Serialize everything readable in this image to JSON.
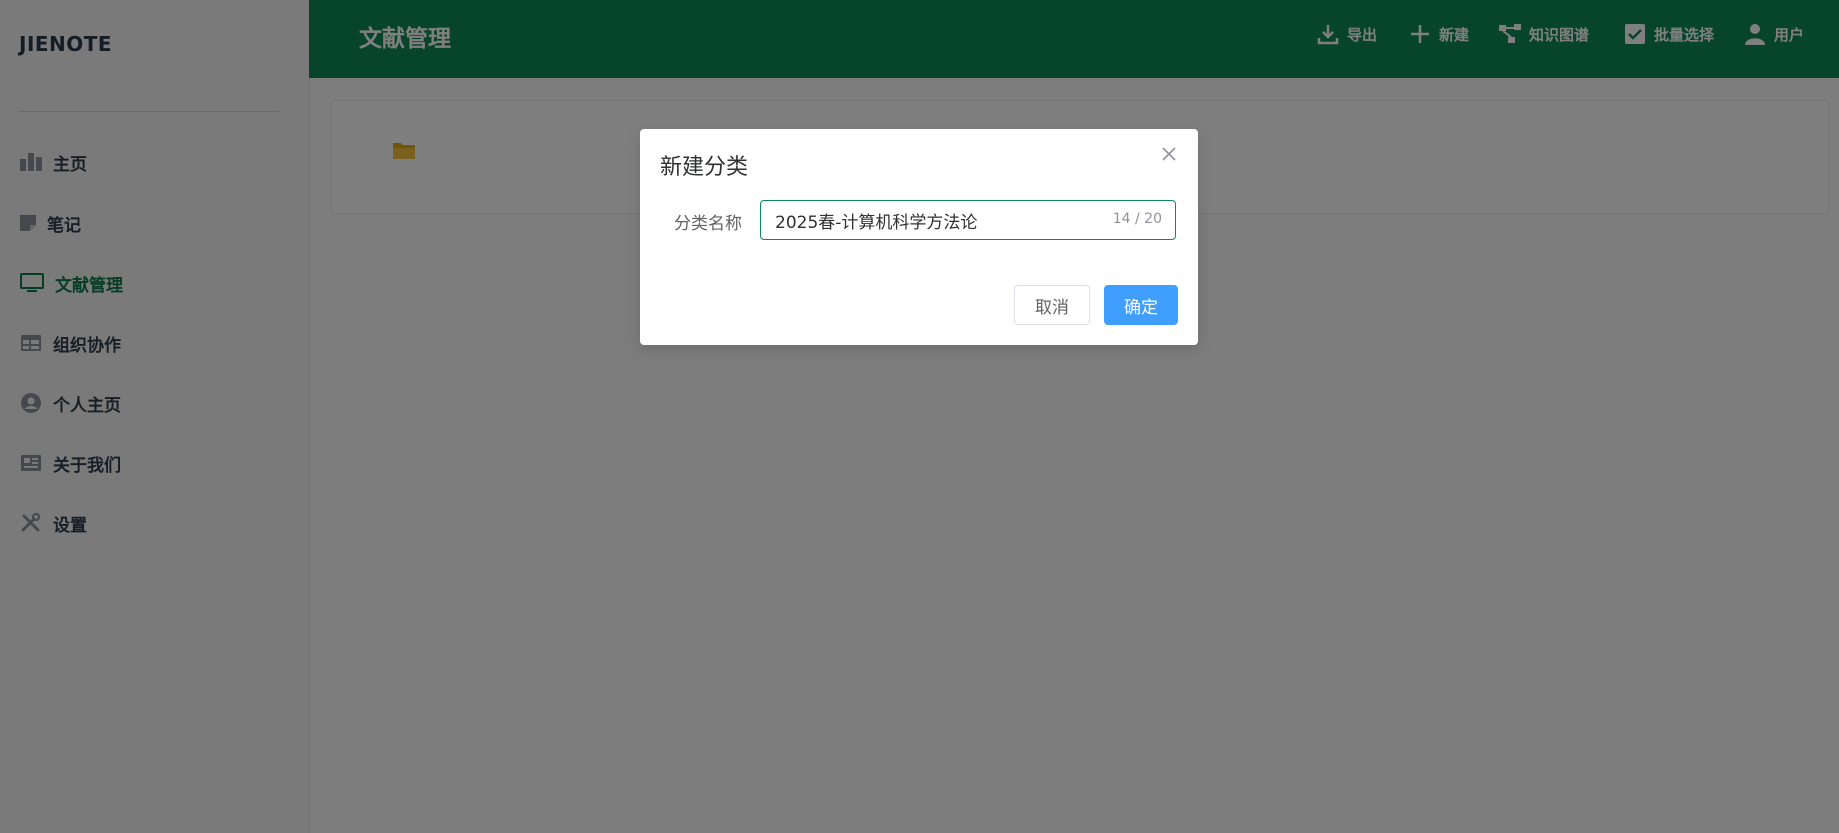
{
  "app": {
    "logo": "JIENOTE"
  },
  "sidebar": {
    "items": [
      {
        "label": "主页",
        "icon": "dashboard-icon",
        "active": false
      },
      {
        "label": "笔记",
        "icon": "note-icon",
        "active": false
      },
      {
        "label": "文献管理",
        "icon": "monitor-icon",
        "active": true
      },
      {
        "label": "组织协作",
        "icon": "table-icon",
        "active": false
      },
      {
        "label": "个人主页",
        "icon": "user-circle-icon",
        "active": false
      },
      {
        "label": "关于我们",
        "icon": "newspaper-icon",
        "active": false
      },
      {
        "label": "设置",
        "icon": "tools-icon",
        "active": false
      }
    ]
  },
  "header": {
    "title": "文献管理",
    "actions": [
      {
        "label": "导出",
        "icon": "download-icon"
      },
      {
        "label": "新建",
        "icon": "plus-icon"
      },
      {
        "label": "知识图谱",
        "icon": "graph-icon"
      },
      {
        "label": "批量选择",
        "icon": "checkbox-icon"
      },
      {
        "label": "用户",
        "icon": "user-icon"
      }
    ]
  },
  "content": {
    "folder_icon": "folder-icon"
  },
  "dialog": {
    "title": "新建分类",
    "field_label": "分类名称",
    "field_value": "2025春-计算机科学方法论",
    "char_count": "14 / 20",
    "cancel_label": "取消",
    "confirm_label": "确定"
  },
  "colors": {
    "brand": "#0f8a57",
    "primary_button": "#409eff",
    "active_nav": "#0d7a4f"
  }
}
